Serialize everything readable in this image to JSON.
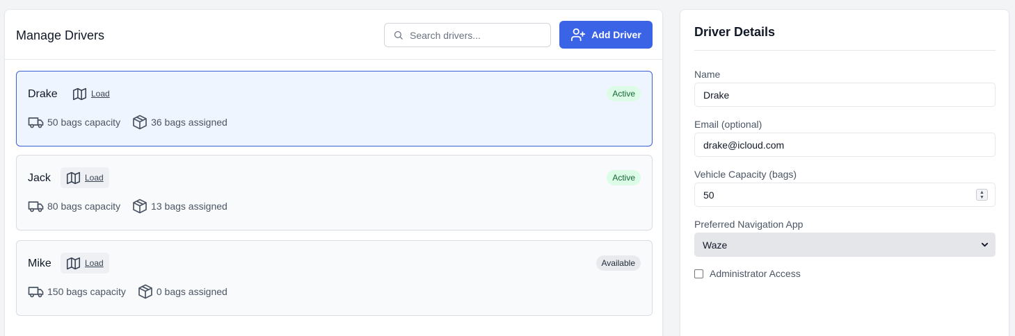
{
  "header": {
    "title": "Manage Drivers",
    "search_placeholder": "Search drivers...",
    "add_button_label": "Add Driver"
  },
  "drivers": [
    {
      "name": "Drake",
      "load_label": "Load",
      "status": "Active",
      "capacity": "50 bags capacity",
      "assigned": "36 bags assigned",
      "selected": true
    },
    {
      "name": "Jack",
      "load_label": "Load",
      "status": "Active",
      "capacity": "80 bags capacity",
      "assigned": "13 bags assigned",
      "selected": false
    },
    {
      "name": "Mike",
      "load_label": "Load",
      "status": "Available",
      "capacity": "150 bags capacity",
      "assigned": "0 bags assigned",
      "selected": false
    }
  ],
  "details": {
    "title": "Driver Details",
    "name_label": "Name",
    "name_value": "Drake",
    "email_label": "Email (optional)",
    "email_value": "drake@icloud.com",
    "capacity_label": "Vehicle Capacity (bags)",
    "capacity_value": "50",
    "nav_label": "Preferred Navigation App",
    "nav_value": "Waze",
    "admin_label": "Administrator Access",
    "admin_checked": false
  },
  "colors": {
    "accent": "#3b63e6",
    "active_badge_bg": "#dcfce7",
    "active_badge_text": "#166534",
    "selected_card_bg": "#eff5ff",
    "selected_card_border": "#3d5fd6"
  },
  "icons": {
    "search": "search-icon",
    "add_user": "user-plus-icon",
    "map": "map-icon",
    "truck": "truck-icon",
    "package": "package-icon",
    "chevron": "chevron-down-icon"
  }
}
